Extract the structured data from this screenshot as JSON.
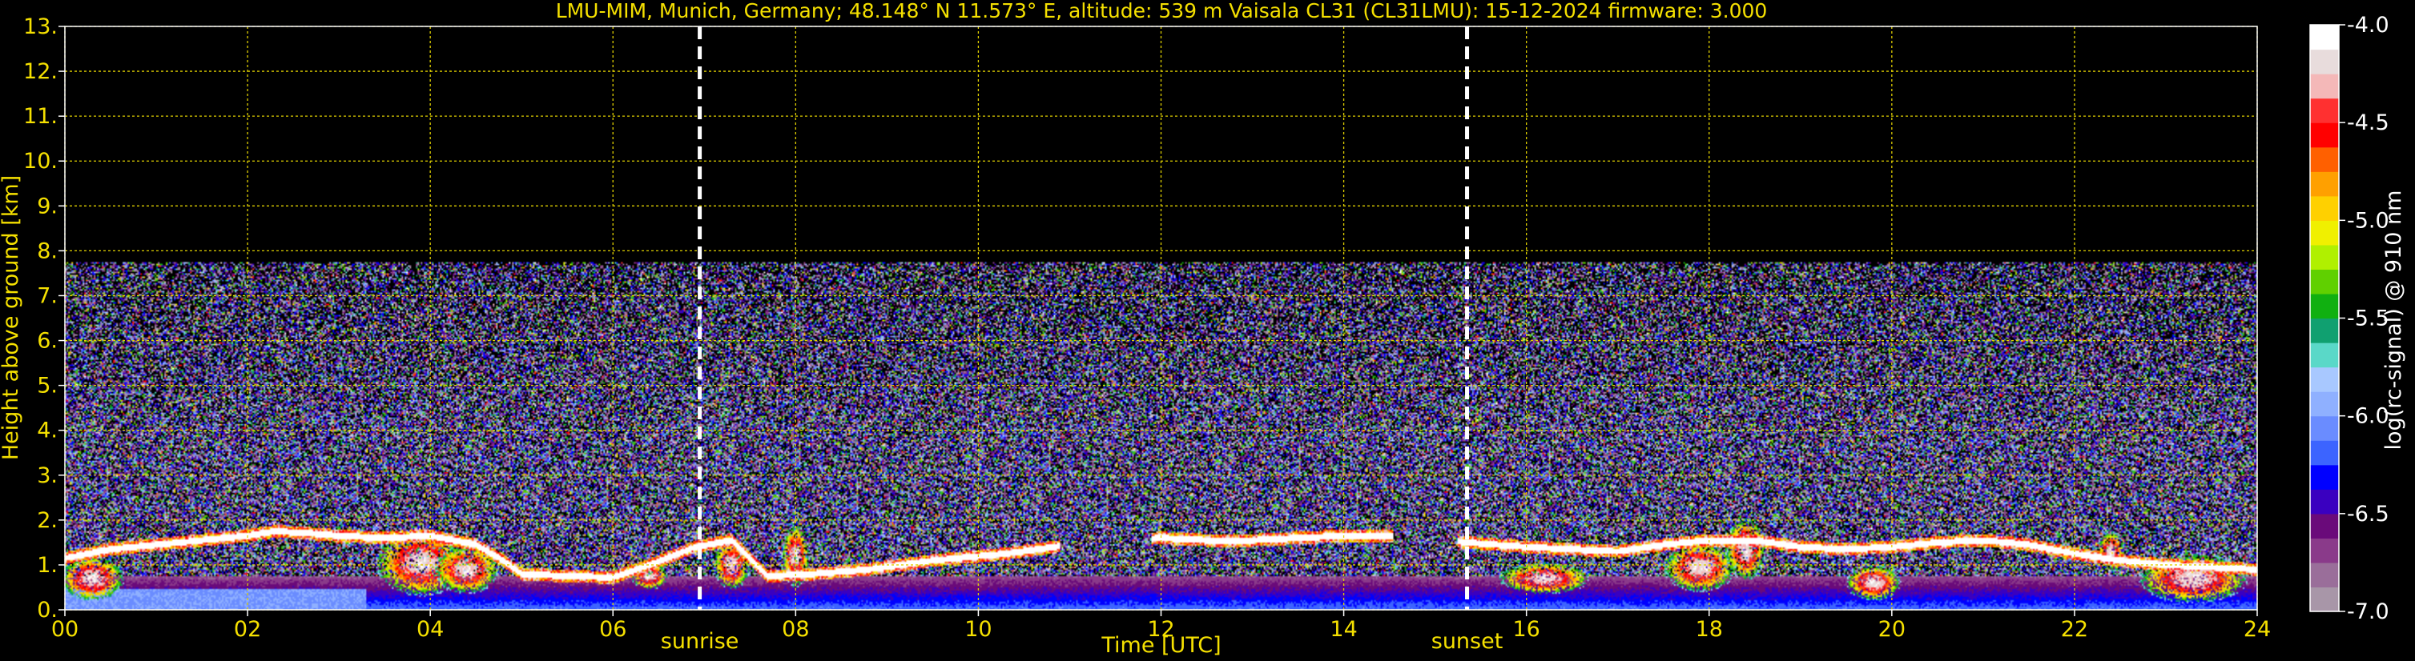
{
  "chart_data": {
    "type": "heatmap",
    "title": "LMU-MIM, Munich, Germany; 48.148° N 11.573° E, altitude: 539 m    Vaisala CL31 (CL31LMU): 15-12-2024    firmware: 3.000",
    "xlabel": "Time [UTC]",
    "ylabel": "Height above ground [km]",
    "xlim": [
      0,
      24
    ],
    "ylim": [
      0,
      13
    ],
    "x_ticks": [
      "00",
      "02",
      "04",
      "06",
      "08",
      "10",
      "12",
      "14",
      "16",
      "18",
      "20",
      "22",
      "24"
    ],
    "y_ticks": [
      "0.",
      "1.",
      "2.",
      "3.",
      "4.",
      "5.",
      "6.",
      "7.",
      "8.",
      "9.",
      "10.",
      "11.",
      "12.",
      "13."
    ],
    "grid": true,
    "colorbar": {
      "label": "log(rc-signal) @ 910 nm",
      "range": [
        -7.0,
        -4.0
      ],
      "ticks": [
        "-4.0",
        "-4.5",
        "-5.0",
        "-5.5",
        "-6.0",
        "-6.5",
        "-7.0"
      ],
      "colors": [
        "#a896a8",
        "#9a6e9a",
        "#8a3a8a",
        "#6a0a7a",
        "#3a00c0",
        "#0000ff",
        "#3c64ff",
        "#6a8cff",
        "#8fb0ff",
        "#a8c8ff",
        "#5ad8c8",
        "#10a070",
        "#10b010",
        "#60d000",
        "#b0f000",
        "#f0f000",
        "#ffd000",
        "#ffa000",
        "#ff6000",
        "#ff0000",
        "#ff3030",
        "#f4b8b8",
        "#e8dcdc",
        "#ffffff"
      ]
    },
    "markers": [
      {
        "label": "sunrise",
        "x": 6.95
      },
      {
        "label": "sunset",
        "x": 15.35
      }
    ],
    "noise_top_km": 7.75,
    "cloud_layer": [
      {
        "x": 0.0,
        "y": 1.15
      },
      {
        "x": 0.5,
        "y": 1.35
      },
      {
        "x": 1.0,
        "y": 1.45
      },
      {
        "x": 1.5,
        "y": 1.55
      },
      {
        "x": 2.0,
        "y": 1.65
      },
      {
        "x": 2.3,
        "y": 1.75
      },
      {
        "x": 2.7,
        "y": 1.7
      },
      {
        "x": 3.0,
        "y": 1.65
      },
      {
        "x": 3.5,
        "y": 1.6
      },
      {
        "x": 4.0,
        "y": 1.65
      },
      {
        "x": 4.5,
        "y": 1.45
      },
      {
        "x": 4.8,
        "y": 1.1
      },
      {
        "x": 5.0,
        "y": 0.8
      },
      {
        "x": 5.5,
        "y": 0.75
      },
      {
        "x": 6.0,
        "y": 0.72
      },
      {
        "x": 6.4,
        "y": 1.0
      },
      {
        "x": 6.9,
        "y": 1.4
      },
      {
        "x": 7.3,
        "y": 1.55
      },
      {
        "x": 7.7,
        "y": 0.75
      },
      {
        "x": 8.2,
        "y": 0.8
      },
      {
        "x": 8.8,
        "y": 0.9
      },
      {
        "x": 9.5,
        "y": 1.1
      },
      {
        "x": 10.3,
        "y": 1.25
      },
      {
        "x": 11.0,
        "y": 1.45
      },
      {
        "x": 12.0,
        "y": 1.6
      },
      {
        "x": 12.5,
        "y": 1.55
      },
      {
        "x": 13.0,
        "y": 1.55
      },
      {
        "x": 13.5,
        "y": 1.6
      },
      {
        "x": 14.0,
        "y": 1.65
      },
      {
        "x": 14.7,
        "y": 1.65
      },
      {
        "x": 15.35,
        "y": 1.5
      },
      {
        "x": 16.0,
        "y": 1.4
      },
      {
        "x": 16.5,
        "y": 1.35
      },
      {
        "x": 17.0,
        "y": 1.3
      },
      {
        "x": 17.5,
        "y": 1.45
      },
      {
        "x": 18.0,
        "y": 1.55
      },
      {
        "x": 18.5,
        "y": 1.55
      },
      {
        "x": 19.0,
        "y": 1.4
      },
      {
        "x": 19.5,
        "y": 1.35
      },
      {
        "x": 20.0,
        "y": 1.4
      },
      {
        "x": 20.5,
        "y": 1.5
      },
      {
        "x": 21.0,
        "y": 1.55
      },
      {
        "x": 21.5,
        "y": 1.45
      },
      {
        "x": 22.0,
        "y": 1.25
      },
      {
        "x": 22.5,
        "y": 1.1
      },
      {
        "x": 23.0,
        "y": 1.0
      },
      {
        "x": 23.5,
        "y": 0.95
      },
      {
        "x": 24.0,
        "y": 0.9
      }
    ]
  }
}
